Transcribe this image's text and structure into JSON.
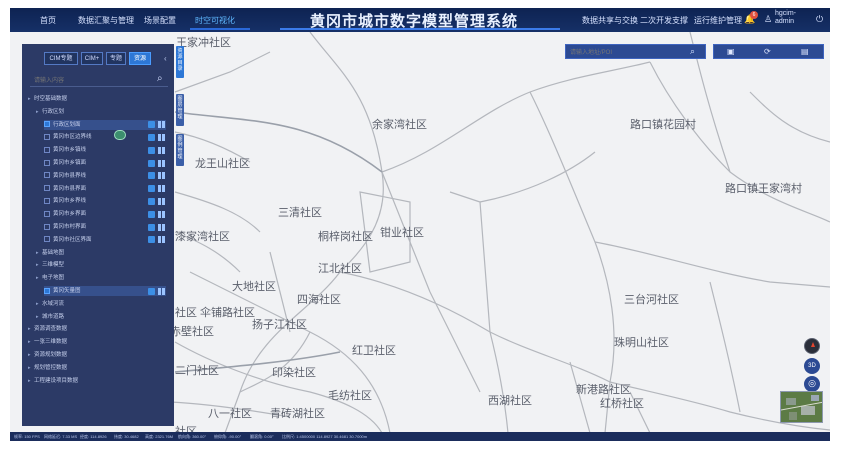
{
  "header": {
    "nav_left": [
      "首页",
      "数据汇聚与管理",
      "场景配置",
      "时空可视化"
    ],
    "active_nav": "时空可视化",
    "title": "黄冈市城市数字模型管理系统",
    "nav_right": [
      "数据共享与交换",
      "二次开发支撑",
      "运行维护管理"
    ],
    "notification_count": "6",
    "user": [
      "hgcim-",
      "admin"
    ]
  },
  "panel": {
    "tabs": [
      "CIM专题",
      "CIM+",
      "专题",
      "资源"
    ],
    "active_tab": "资源",
    "search_placeholder": "请输入内容",
    "tree": [
      {
        "label": "时空基础数据",
        "level": 0,
        "type": "folder"
      },
      {
        "label": "行政区划",
        "level": 1,
        "type": "folder"
      },
      {
        "label": "行政区划面",
        "level": 2,
        "type": "layer",
        "checked": true,
        "selected": true
      },
      {
        "label": "黄冈市区边界线",
        "level": 2,
        "type": "layer",
        "checked": false
      },
      {
        "label": "黄冈市乡镇线",
        "level": 2,
        "type": "layer",
        "checked": false
      },
      {
        "label": "黄冈市乡镇面",
        "level": 2,
        "type": "layer",
        "checked": false
      },
      {
        "label": "黄冈市县界线",
        "level": 2,
        "type": "layer",
        "checked": false
      },
      {
        "label": "黄冈市县界面",
        "level": 2,
        "type": "layer",
        "checked": false
      },
      {
        "label": "黄冈市乡界线",
        "level": 2,
        "type": "layer",
        "checked": false
      },
      {
        "label": "黄冈市乡界面",
        "level": 2,
        "type": "layer",
        "checked": false
      },
      {
        "label": "黄冈市村界面",
        "level": 2,
        "type": "layer",
        "checked": false
      },
      {
        "label": "黄冈市社区界面",
        "level": 2,
        "type": "layer",
        "checked": false
      },
      {
        "label": "基础地图",
        "level": 1,
        "type": "folder"
      },
      {
        "label": "三维模型",
        "level": 1,
        "type": "folder"
      },
      {
        "label": "电子地图",
        "level": 1,
        "type": "folder"
      },
      {
        "label": "黄冈矢量图",
        "level": 2,
        "type": "layer",
        "checked": true,
        "selected": true
      },
      {
        "label": "水域河流",
        "level": 1,
        "type": "folder"
      },
      {
        "label": "城市道路",
        "level": 1,
        "type": "folder"
      },
      {
        "label": "资源调查数据",
        "level": 0,
        "type": "folder"
      },
      {
        "label": "一张三维数据",
        "level": 0,
        "type": "folder"
      },
      {
        "label": "资源规划数据",
        "level": 0,
        "type": "folder"
      },
      {
        "label": "规划管控数据",
        "level": 0,
        "type": "folder"
      },
      {
        "label": "工程建设项目数据",
        "level": 0,
        "type": "folder"
      }
    ],
    "side_tabs": [
      "资源目录",
      "图层管理",
      "图例管理"
    ]
  },
  "map": {
    "search_placeholder": "请输入地址/POI",
    "places": [
      "王家冲社区",
      "余家湾社区",
      "路口镇花园村",
      "龙王山社区",
      "路口镇王家湾村",
      "三清社区",
      "桐梓岗社区",
      "钳业社区",
      "漆家湾社区",
      "江北社区",
      "大地社区",
      "四海社区",
      "三台河社区",
      "社区",
      "伞铺路社区",
      "扬子江社区",
      "赤壁社区",
      "红卫社区",
      "珠明山社区",
      "二门社区",
      "印染社区",
      "毛纺社区",
      "新港路社区",
      "西湖社区",
      "红桥社区",
      "八一社区",
      "青砖湖社区",
      "社区"
    ],
    "controls": {
      "three_d_label": "3D"
    }
  },
  "status_bar": {
    "items": [
      "帧率: 150 FPS",
      "网络延迟: 7.33 MS",
      "经度: 114.8926",
      "纬度: 30.4682",
      "高度: 2321.76M",
      "航向角: 360.00°",
      "俯仰角: -90.00°",
      "翻滚角: 0.00°",
      "比例尺: 1:4500000  114.8927 30.4681 30.7000m"
    ]
  },
  "colors": {
    "header_bg": "#0e2352",
    "panel_bg": "#2c3a66",
    "accent": "#2d77d6",
    "map_bg": "#f1f2f4",
    "road": "#b4b7bd"
  }
}
